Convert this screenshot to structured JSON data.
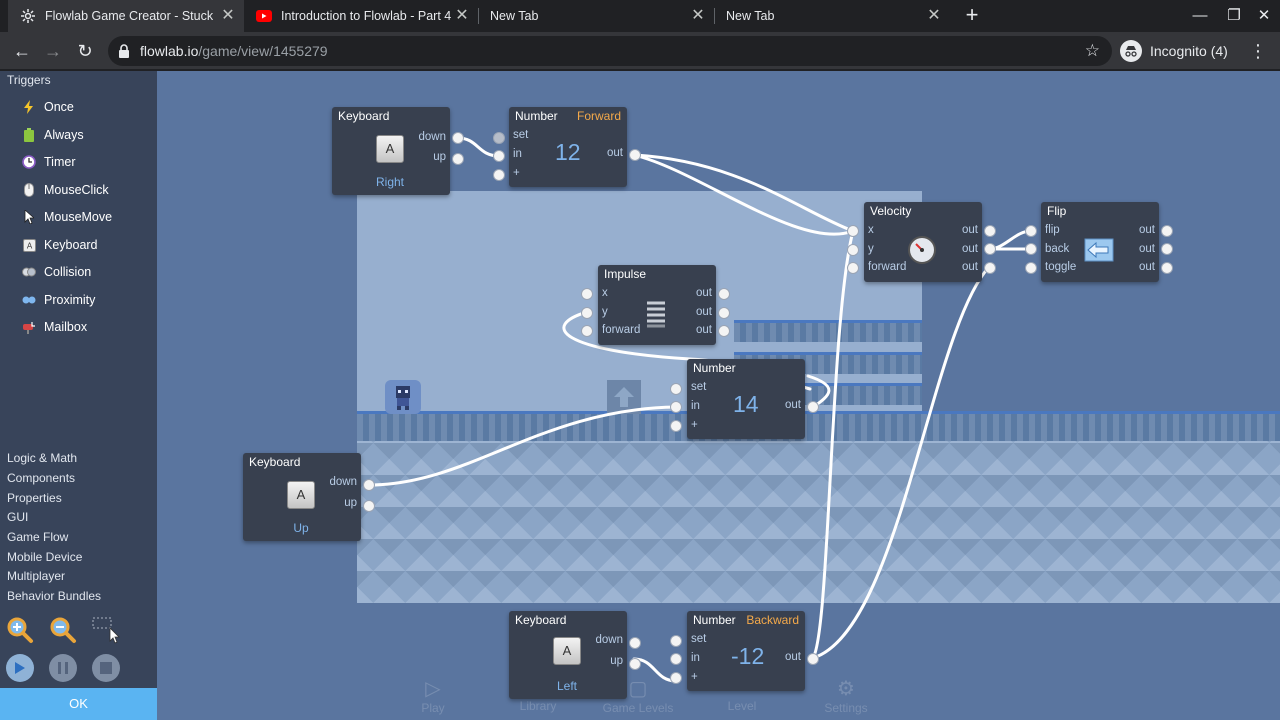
{
  "browser": {
    "tabs": [
      {
        "title": "Flowlab Game Creator - Stuck",
        "active": true,
        "icon": "flowlab-icon"
      },
      {
        "title": "Introduction to Flowlab - Part 4 -",
        "active": false,
        "icon": "youtube-icon"
      },
      {
        "title": "New Tab",
        "active": false,
        "icon": ""
      },
      {
        "title": "New Tab",
        "active": false,
        "icon": ""
      }
    ],
    "url_domain": "flowlab.io",
    "url_path": "/game/view/1455279",
    "profile_label": "Incognito (4)"
  },
  "sidebar": {
    "heading": "Triggers",
    "triggers": [
      {
        "label": "Once",
        "icon": "lightning-icon"
      },
      {
        "label": "Always",
        "icon": "battery-icon"
      },
      {
        "label": "Timer",
        "icon": "clock-icon"
      },
      {
        "label": "MouseClick",
        "icon": "mouse-icon"
      },
      {
        "label": "MouseMove",
        "icon": "cursor-icon"
      },
      {
        "label": "Keyboard",
        "icon": "key-icon"
      },
      {
        "label": "Collision",
        "icon": "collision-icon"
      },
      {
        "label": "Proximity",
        "icon": "proximity-icon"
      },
      {
        "label": "Mailbox",
        "icon": "mailbox-icon"
      }
    ],
    "categories": [
      "Logic & Math",
      "Components",
      "Properties",
      "GUI",
      "Game Flow",
      "Mobile Device",
      "Multiplayer",
      "Behavior Bundles"
    ],
    "ok_label": "OK"
  },
  "nodes": {
    "kb_right": {
      "title": "Keyboard",
      "key": "A",
      "sub": "Right",
      "out1": "down",
      "out2": "up"
    },
    "num_forward": {
      "title": "Number",
      "tag": "Forward",
      "value": "12",
      "in1": "set",
      "in2": "in",
      "in3": "+",
      "out": "out"
    },
    "velocity": {
      "title": "Velocity",
      "in1": "x",
      "in2": "y",
      "in3": "forward",
      "out1": "out",
      "out2": "out",
      "out3": "out"
    },
    "flip": {
      "title": "Flip",
      "in1": "flip",
      "in2": "back",
      "in3": "toggle",
      "out1": "out",
      "out2": "out",
      "out3": "out"
    },
    "impulse": {
      "title": "Impulse",
      "in1": "x",
      "in2": "y",
      "in3": "forward",
      "out1": "out",
      "out2": "out",
      "out3": "out"
    },
    "num_jump": {
      "title": "Number",
      "value": "14",
      "in1": "set",
      "in2": "in",
      "in3": "+",
      "out": "out"
    },
    "kb_up": {
      "title": "Keyboard",
      "key": "A",
      "sub": "Up",
      "out1": "down",
      "out2": "up"
    },
    "kb_left": {
      "title": "Keyboard",
      "key": "A",
      "sub": "Left",
      "out1": "down",
      "out2": "up"
    },
    "num_backward": {
      "title": "Number",
      "tag": "Backward",
      "value": "-12",
      "in1": "set",
      "in2": "in",
      "in3": "+",
      "out": "out"
    }
  },
  "footer_tabs": [
    "Play",
    "Library",
    "Game Levels",
    "Level",
    "Settings"
  ]
}
